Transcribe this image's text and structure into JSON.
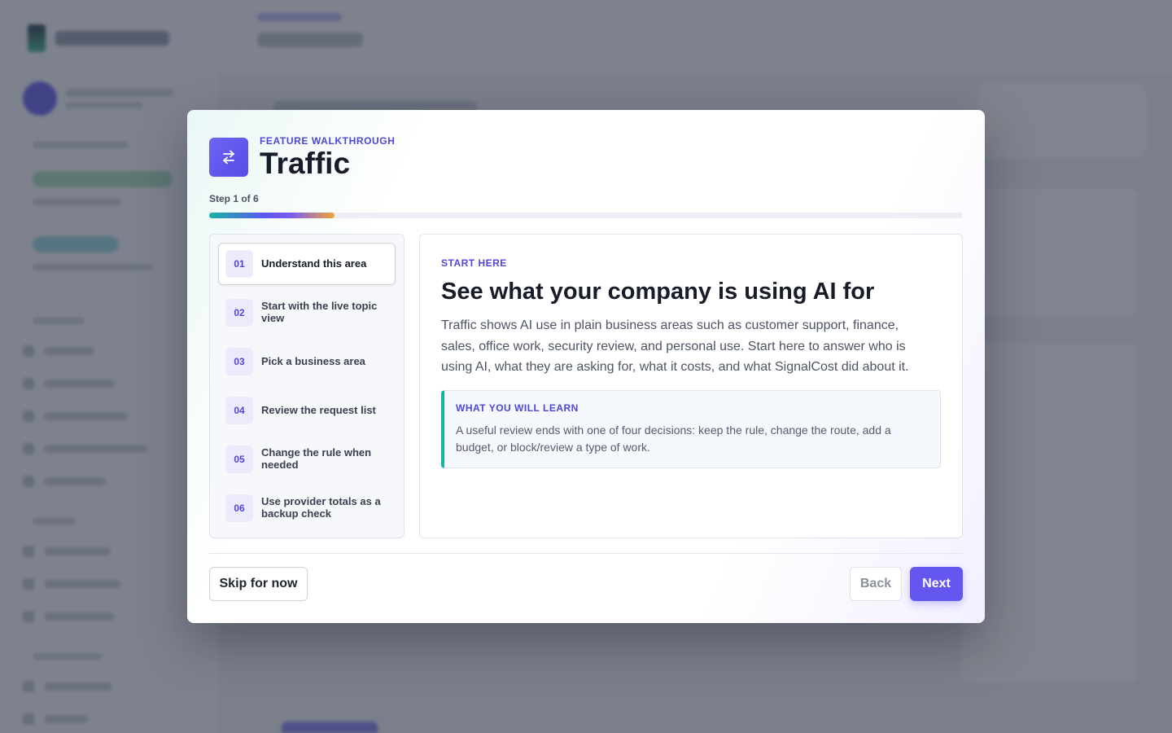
{
  "walkthrough": {
    "eyebrow": "FEATURE WALKTHROUGH",
    "title": "Traffic",
    "icon": "arrows-exchange-icon",
    "step_label": "Step 1 of 6",
    "progress": {
      "current": 1,
      "total": 6
    },
    "accent_color": "#5a52e8",
    "steps": [
      {
        "num": "01",
        "label": "Understand this area",
        "active": true
      },
      {
        "num": "02",
        "label": "Start with the live topic view",
        "active": false
      },
      {
        "num": "03",
        "label": "Pick a business area",
        "active": false
      },
      {
        "num": "04",
        "label": "Review the request list",
        "active": false
      },
      {
        "num": "05",
        "label": "Change the rule when needed",
        "active": false
      },
      {
        "num": "06",
        "label": "Use provider totals as a backup check",
        "active": false
      }
    ],
    "content": {
      "eyebrow": "START HERE",
      "title": "See what your company is using AI for",
      "body": "Traffic shows AI use in plain business areas such as customer support, finance, sales, office work, security review, and personal use. Start here to answer who is using AI, what they are asking for, what it costs, and what SignalCost did about it.",
      "learn_title": "WHAT YOU WILL LEARN",
      "learn_body": "A useful review ends with one of four decisions: keep the rule, change the route, add a budget, or block/review a type of work."
    },
    "buttons": {
      "skip": "Skip for now",
      "back": "Back",
      "next": "Next"
    }
  }
}
